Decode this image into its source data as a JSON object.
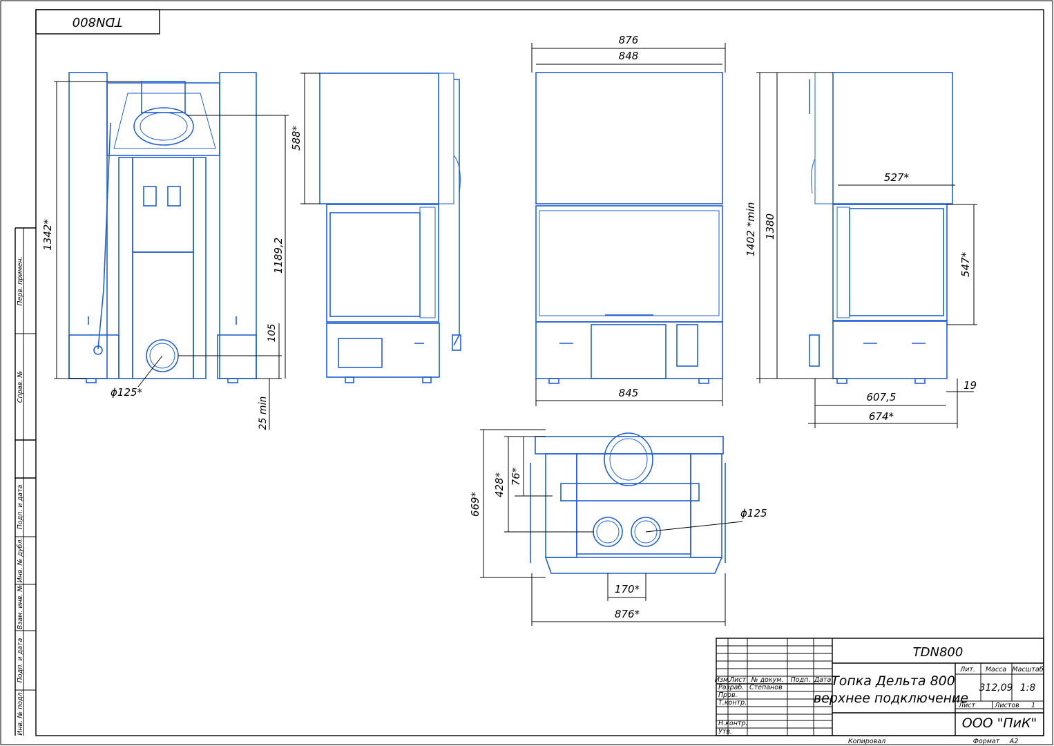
{
  "sheet": {
    "mirrored_tag": "TDN800",
    "side_labels": [
      "Перв. примен.",
      "Справ. №",
      "Подп. и дата",
      "Инв. № дубл.",
      "Взам. инв. №",
      "Подп. и дата",
      "Инв. № подл."
    ]
  },
  "dimensions": {
    "front": {
      "height_total": "1342*",
      "height_mid": "1189,2",
      "d105": "105",
      "d25": "25 min",
      "diam": "ϕ125*"
    },
    "side": {
      "upper": "588*"
    },
    "top_view": {
      "w876": "876",
      "w848": "848",
      "w845": "845"
    },
    "right_view": {
      "h1402": "1402 *min",
      "h1380": "1380",
      "w527": "527*",
      "h547": "547*",
      "d19": "19",
      "d6075": "607,5",
      "d674": "674*"
    },
    "plan": {
      "d669": "669*",
      "d428": "428*",
      "d76": "76*",
      "diam": "ϕ125",
      "d170": "170*",
      "d876": "876*"
    }
  },
  "title_block": {
    "code": "TDN800",
    "name_line1": "Топка Дельта 800",
    "name_line2": "верхнее подключение",
    "col_lit": "Лит.",
    "col_mass": "Масса",
    "col_scale": "Масштаб",
    "mass": "312,09",
    "scale": "1:8",
    "sheet_label": "Лист",
    "sheets_label": "Листов",
    "sheets_value": "1",
    "company": "ООО \"ПиК\"",
    "rows": {
      "izm": "Изм.",
      "list": "Лист",
      "doc": "№ докум.",
      "sign": "Подп.",
      "date": "Дата",
      "razrab": "Разраб.",
      "razrab_name": "Степанов",
      "prov": "Пров.",
      "tkontr": "Т.контр.",
      "nkontr": "Н.контр.",
      "utv": "Утв."
    },
    "copied": "Копировал",
    "format_label": "Формат",
    "format_value": "A2"
  }
}
